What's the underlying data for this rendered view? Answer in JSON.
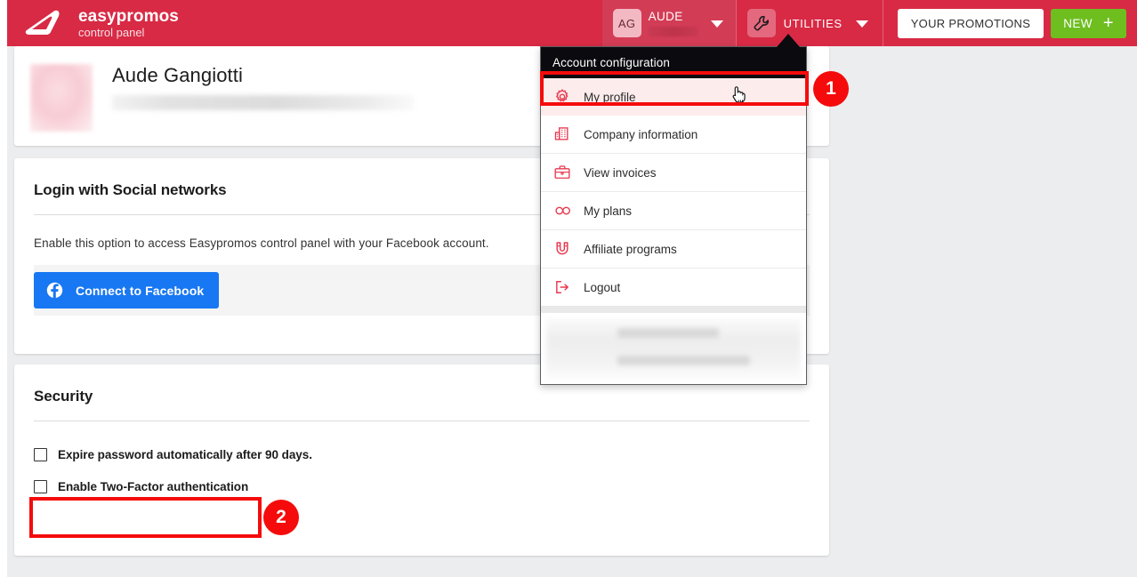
{
  "header": {
    "brand_name": "easypromos",
    "brand_sub": "control panel",
    "logo_icon": "easypromos-flag-logo",
    "account": {
      "avatar_initials": "AG",
      "name": "AUDE",
      "caret_icon": "chevron-down-icon"
    },
    "utilities": {
      "icon": "wrench-icon",
      "label": "UTILITIES",
      "caret_icon": "chevron-down-icon"
    },
    "your_promotions_label": "YOUR PROMOTIONS",
    "new_label": "NEW",
    "new_plus_icon": "plus-icon",
    "colors": {
      "header_red": "#d82a45",
      "account_red": "#d33c55",
      "new_green": "#6ebe20",
      "facebook_blue": "#1877f2",
      "annotation_red": "#f50b0b"
    }
  },
  "dropdown": {
    "title": "Account configuration",
    "cursor_icon": "pointing-hand-cursor",
    "items": [
      {
        "label": "My profile",
        "icon": "gear-icon",
        "active": true
      },
      {
        "label": "Company information",
        "icon": "building-icon",
        "active": false
      },
      {
        "label": "View invoices",
        "icon": "briefcase-icon",
        "active": false
      },
      {
        "label": "My plans",
        "icon": "infinity-icon",
        "active": false
      },
      {
        "label": "Affiliate programs",
        "icon": "magnet-icon",
        "active": false
      },
      {
        "label": "Logout",
        "icon": "logout-arrow-icon",
        "active": false
      }
    ]
  },
  "profile": {
    "name": "Aude Gangiotti",
    "avatar_icon": "user-avatar-image"
  },
  "social": {
    "title": "Login with Social networks",
    "description": "Enable this option to access Easypromos control panel with your Facebook account.",
    "connect_button": {
      "label": "Connect to Facebook",
      "icon": "facebook-icon"
    }
  },
  "security": {
    "title": "Security",
    "checkboxes": [
      {
        "label": "Expire password automatically after 90 days.",
        "checked": false
      },
      {
        "label": "Enable Two-Factor authentication",
        "checked": false
      }
    ]
  },
  "annotations": {
    "badge_1": "1",
    "badge_2": "2"
  }
}
